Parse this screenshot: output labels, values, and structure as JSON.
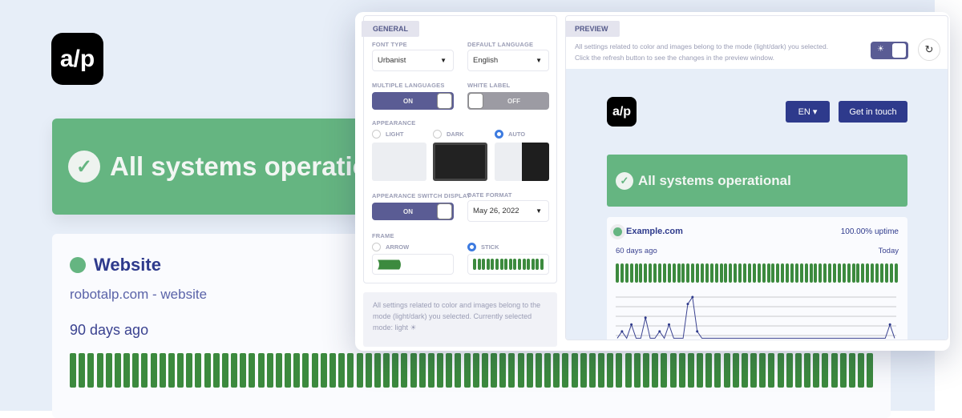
{
  "background": {
    "logo_text": "a/p",
    "banner_text": "All systems operational",
    "website": {
      "title": "Website",
      "subtitle": "robotalp.com - website",
      "range_label": "90 days ago",
      "days": 90,
      "status_color": "#65b581"
    }
  },
  "general": {
    "tab": "GENERAL",
    "font_type": {
      "label": "FONT TYPE",
      "value": "Urbanist"
    },
    "default_language": {
      "label": "DEFAULT LANGUAGE",
      "value": "English"
    },
    "multiple_languages": {
      "label": "MULTIPLE LANGUAGES",
      "state": "ON"
    },
    "white_label": {
      "label": "WHITE LABEL",
      "state": "OFF"
    },
    "appearance": {
      "label": "APPEARANCE",
      "options": [
        "LIGHT",
        "DARK",
        "AUTO"
      ],
      "selected": "AUTO"
    },
    "appearance_switch": {
      "label": "APPEARANCE SWITCH DISPLAY",
      "state": "ON"
    },
    "date_format": {
      "label": "DATE FORMAT",
      "value": "May 26, 2022"
    },
    "frame": {
      "label": "FRAME",
      "options": [
        "ARROW",
        "STICK"
      ],
      "selected": "STICK"
    },
    "note": "All settings related to color and images belong to the mode (light/dark) you selected. Currently selected mode: light ☀"
  },
  "preview": {
    "tab": "PREVIEW",
    "note_line1": "All settings related to color and images belong to the mode (light/dark) you selected.",
    "note_line2": "Click the refresh button to see the changes in the preview window.",
    "mode_icon": "☀",
    "refresh_icon": "↻",
    "logo_text": "a/p",
    "lang_button": "EN ▾",
    "cta_button": "Get in touch",
    "banner_text": "All systems operational",
    "monitor": {
      "name": "Example.com",
      "uptime": "100.00% uptime",
      "start_label": "60 days ago",
      "end_label": "Today",
      "days": 60
    },
    "response_series": [
      1,
      2,
      1,
      3,
      1,
      1,
      4,
      1,
      1,
      2,
      1,
      3,
      1,
      1,
      1,
      6,
      7,
      2,
      1,
      1,
      1,
      1,
      1,
      1,
      1,
      1,
      1,
      1,
      1,
      1,
      1,
      1,
      1,
      1,
      1,
      1,
      1,
      1,
      1,
      1,
      1,
      1,
      1,
      1,
      1,
      1,
      1,
      1,
      1,
      1,
      1,
      1,
      1,
      1,
      1,
      1,
      1,
      1,
      3,
      1
    ]
  },
  "colors": {
    "accent": "#2e3a8c",
    "success": "#65b581",
    "bar": "#3c8a3e",
    "toggle": "#5a5c94"
  }
}
